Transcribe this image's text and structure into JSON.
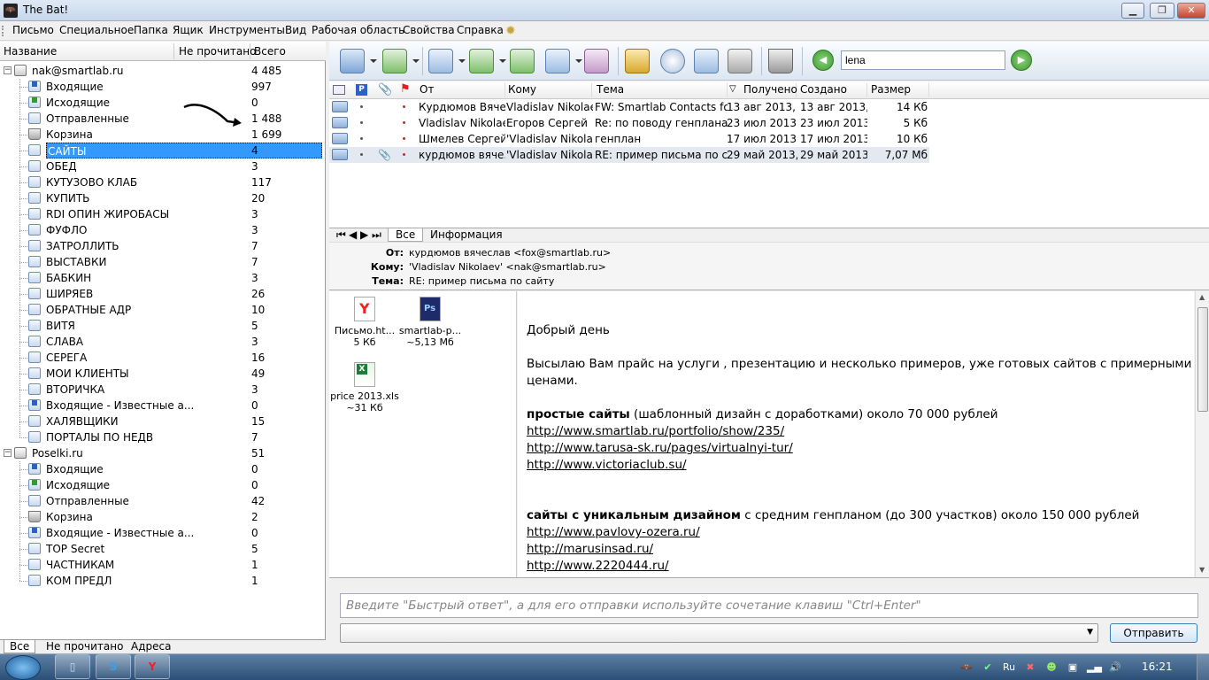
{
  "window": {
    "title": "The Bat!",
    "minimize": "▁",
    "maximize": "❐",
    "close": "✕"
  },
  "menu": [
    "Письмо",
    "Специальное",
    "Папка",
    "Ящик",
    "Инструменты",
    "Вид",
    "Рабочая область",
    "Свойства",
    "Справка"
  ],
  "folder_tree": {
    "headers": {
      "name": "Название",
      "unread": "Не прочитано",
      "total": "Всего"
    },
    "accounts": [
      {
        "name": "nak@smartlab.ru",
        "total": "4 485",
        "folders": [
          {
            "name": "Входящие",
            "total": "997",
            "icon": "inbox-icon"
          },
          {
            "name": "Исходящие",
            "total": "0",
            "icon": "outbox-icon"
          },
          {
            "name": "Отправленные",
            "total": "1 488",
            "icon": "sent-folder-icon"
          },
          {
            "name": "Корзина",
            "total": "1 699",
            "icon": "trash-icon"
          },
          {
            "name": "САЙТЫ",
            "total": "4",
            "icon": "folder-icon",
            "selected": true
          },
          {
            "name": "ОБЕД",
            "total": "3",
            "icon": "folder-icon"
          },
          {
            "name": "КУТУЗОВО КЛАБ",
            "total": "117",
            "icon": "folder-icon"
          },
          {
            "name": "КУПИТЬ",
            "total": "20",
            "icon": "folder-icon"
          },
          {
            "name": "RDI ОПИН ЖИРОБАСЫ",
            "total": "3",
            "icon": "folder-icon"
          },
          {
            "name": "ФУФЛО",
            "total": "3",
            "icon": "folder-icon"
          },
          {
            "name": "ЗАТРОЛЛИТЬ",
            "total": "7",
            "icon": "folder-icon"
          },
          {
            "name": "ВЫСТАВКИ",
            "total": "7",
            "icon": "folder-icon"
          },
          {
            "name": "БАБКИН",
            "total": "3",
            "icon": "folder-icon"
          },
          {
            "name": "ШИРЯЕВ",
            "total": "26",
            "icon": "folder-icon"
          },
          {
            "name": "ОБРАТНЫЕ АДР",
            "total": "10",
            "icon": "folder-icon"
          },
          {
            "name": "ВИТЯ",
            "total": "5",
            "icon": "folder-icon"
          },
          {
            "name": "СЛАВА",
            "total": "3",
            "icon": "folder-icon"
          },
          {
            "name": "СЕРЕГА",
            "total": "16",
            "icon": "folder-icon"
          },
          {
            "name": "МОИ КЛИЕНТЫ",
            "total": "49",
            "icon": "folder-icon"
          },
          {
            "name": "ВТОРИЧКА",
            "total": "3",
            "icon": "folder-icon"
          },
          {
            "name": "Входящие - Известные а...",
            "total": "0",
            "icon": "inbox-icon"
          },
          {
            "name": "ХАЛЯВЩИКИ",
            "total": "15",
            "icon": "folder-icon"
          },
          {
            "name": "ПОРТАЛЫ ПО НЕДВ",
            "total": "7",
            "icon": "folder-icon"
          }
        ]
      },
      {
        "name": "Poselki.ru",
        "total": "51",
        "folders": [
          {
            "name": "Входящие",
            "total": "0",
            "icon": "inbox-icon"
          },
          {
            "name": "Исходящие",
            "total": "0",
            "icon": "outbox-icon"
          },
          {
            "name": "Отправленные",
            "total": "42",
            "icon": "sent-folder-icon"
          },
          {
            "name": "Корзина",
            "total": "2",
            "icon": "trash-icon"
          },
          {
            "name": "Входящие - Известные а...",
            "total": "0",
            "icon": "inbox-icon"
          },
          {
            "name": "TOP Secret",
            "total": "5",
            "icon": "folder-icon"
          },
          {
            "name": "ЧАСТНИКАМ",
            "total": "1",
            "icon": "folder-icon"
          },
          {
            "name": "КОМ ПРЕДЛ",
            "total": "1",
            "icon": "folder-icon"
          }
        ]
      }
    ],
    "tabs": [
      "Все",
      "Не прочитано",
      "Адреса"
    ]
  },
  "toolbar": {
    "search_value": "lena",
    "nav_back": "◀",
    "nav_forward": "▶"
  },
  "message_list": {
    "headers": {
      "from": "От",
      "to": "Кому",
      "subject": "Тема",
      "received": "Получено",
      "created": "Создано",
      "size": "Размер"
    },
    "rows": [
      {
        "from": "Курдюмов Вяче...",
        "to": "Vladislav Nikolaev",
        "subject": "FW: Smartlab Contacts fo...",
        "received": "13 авг 2013, ...",
        "created": "13 авг 2013, ...",
        "size": "14 Кб",
        "attach": false
      },
      {
        "from": "Vladislav Nikolaev",
        "to": "Егоров Сергей",
        "subject": "Re: по поводу генплана (...",
        "received": "23 июл 2013, ...",
        "created": "23 июл 2013...",
        "size": "5 Кб",
        "attach": false
      },
      {
        "from": "Шмелев Сергей",
        "to": "'Vladislav Nikola...",
        "subject": "генплан",
        "received": "17 июл 2013...",
        "created": "17 июл 2013...",
        "size": "10 Кб",
        "attach": false
      },
      {
        "from": "курдюмов вяче...",
        "to": "'Vladislav Nikola...",
        "subject": "RE: пример письма по с...",
        "received": "29 май 2013,...",
        "created": "29 май 2013,...",
        "size": "7,07 Мб",
        "attach": true,
        "selected": true
      }
    ]
  },
  "preview": {
    "tabs": [
      "Все",
      "Информация"
    ],
    "from_label": "От:",
    "from": "курдюмов вячеслав <fox@smartlab.ru>",
    "to_label": "Кому:",
    "to": "'Vladislav Nikolaev' <nak@smartlab.ru>",
    "subject_label": "Тема:",
    "subject": "RE: пример письма по сайту",
    "attachments": [
      {
        "name": "Письмо.ht...",
        "size": "5 Кб",
        "icon": "yandex-html-icon"
      },
      {
        "name": "smartlab-p...",
        "size": "~5,13 Мб",
        "icon": "photoshop-file-icon"
      },
      {
        "name": "price 2013.xls",
        "size": "~31 Кб",
        "icon": "excel-file-icon"
      }
    ],
    "body": {
      "greeting": "Добрый день",
      "line1": "Высылаю Вам прайс на услуги , презентацию и несколько примеров, уже готовых сайтов с примерными",
      "line2": "ценами.",
      "simple_bold": "простые сайты",
      "simple_rest": " (шаблонный дизайн с доработками) около 70 000 рублей",
      "links1": [
        "http://www.smartlab.ru/portfolio/show/235/",
        "http://www.tarusa-sk.ru/pages/virtualnyi-tur/",
        "http://www.victoriaclub.su/"
      ],
      "unique_bold": "сайты с уникальным дизайном",
      "unique_rest": " с средним генпланом (до 300 участков) около  150 000 рублей",
      "links2": [
        "http://www.pavlovy-ozera.ru/",
        "http://marusinsad.ru/",
        "http://www.2220444.ru/"
      ]
    }
  },
  "quick_reply": {
    "placeholder": "Введите \"Быстрый ответ\", а для его отправки используйте сочетание клавиш \"Ctrl+Enter\"",
    "send": "Отправить"
  },
  "taskbar": {
    "clock": "16:21",
    "lang": "Ru"
  }
}
